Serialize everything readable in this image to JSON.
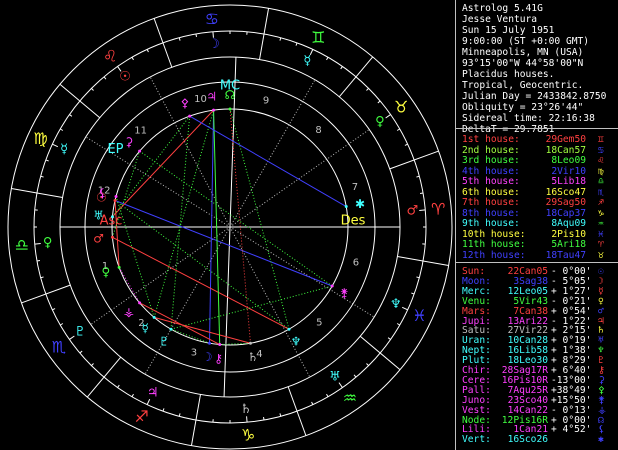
{
  "app": {
    "title": "Astrolog 5.41G"
  },
  "chart_info": {
    "name": "Jesse Ventura",
    "date": "Sun 15 July 1951",
    "time": "9:00:00 (ST +0:00 GMT)",
    "place": "Minneapolis, MN (USA)",
    "coords": "93°15'00\"W 44°58'00\"N",
    "system": "Placidus houses.",
    "zodiac": "Tropical, Geocentric.",
    "julian": "Julian Day = 2433842.8750",
    "obliquity": "Obliquity = 23°26'44\"",
    "sidereal": "Sidereal time: 22:16:38",
    "deltat": "DeltaT = 29.7851"
  },
  "houses": [
    {
      "label": "1st house:",
      "value": "29Gem50",
      "glyph": "♊",
      "color": "#ff4040",
      "gcolor": "#ff4040"
    },
    {
      "label": "2nd house:",
      "value": "18Can57",
      "glyph": "♋",
      "color": "#a0ff40",
      "gcolor": "#4040ff"
    },
    {
      "label": "3rd house:",
      "value": "8Leo09",
      "glyph": "♌",
      "color": "#40ff40",
      "gcolor": "#ff4040"
    },
    {
      "label": "4th house:",
      "value": "2Vir10",
      "glyph": "♍",
      "color": "#4040ff",
      "gcolor": "#ffff40"
    },
    {
      "label": "5th house:",
      "value": "5Lib18",
      "glyph": "♎",
      "color": "#ff40ff",
      "gcolor": "#40ff40"
    },
    {
      "label": "6th house:",
      "value": "16Sco47",
      "glyph": "♏",
      "color": "#ffff40",
      "gcolor": "#4040ff"
    },
    {
      "label": "7th house:",
      "value": "29Sag50",
      "glyph": "♐",
      "color": "#ff4040",
      "gcolor": "#ff4040"
    },
    {
      "label": "8th house:",
      "value": "18Cap37",
      "glyph": "♑",
      "color": "#4040ff",
      "gcolor": "#ffff40"
    },
    {
      "label": "9th house:",
      "value": "8Aqu09",
      "glyph": "♒",
      "color": "#40ffff",
      "gcolor": "#40ff40"
    },
    {
      "label": "10th house:",
      "value": "2Pis10",
      "glyph": "♓",
      "color": "#ffff40",
      "gcolor": "#4040ff"
    },
    {
      "label": "11th house:",
      "value": "5Ari18",
      "glyph": "♈",
      "color": "#40ff40",
      "gcolor": "#ff4040"
    },
    {
      "label": "12th house:",
      "value": "18Tau47",
      "glyph": "♉",
      "color": "#4040ff",
      "gcolor": "#ffff40"
    }
  ],
  "planets": [
    {
      "label": "Sun:",
      "pos": "22Can05",
      "lat": "- 0°00'",
      "glyph": "☉",
      "color": "#ff4040",
      "pcolor": "#4040ff"
    },
    {
      "label": "Moon:",
      "pos": "3Sag38",
      "lat": "- 5°05'",
      "glyph": "☽",
      "color": "#4040ff",
      "pcolor": "#ff4040"
    },
    {
      "label": "Merc:",
      "pos": "12Leo05",
      "lat": "+ 1°27'",
      "glyph": "☿",
      "color": "#40ffff",
      "pcolor": "#ff4040"
    },
    {
      "label": "Venu:",
      "pos": "5Vir43",
      "lat": "- 0°21'",
      "glyph": "♀",
      "color": "#40ff40",
      "pcolor": "#ffff40"
    },
    {
      "label": "Mars:",
      "pos": "7Can38",
      "lat": "+ 0°54'",
      "glyph": "♂",
      "color": "#ff4040",
      "pcolor": "#4040ff"
    },
    {
      "label": "Jupi:",
      "pos": "13Ari22",
      "lat": "- 1°22'",
      "glyph": "♃",
      "color": "#ff40ff",
      "pcolor": "#ff4040"
    },
    {
      "label": "Satu:",
      "pos": "27Vir22",
      "lat": "+ 2°15'",
      "glyph": "♄",
      "color": "#c0c0c0",
      "pcolor": "#ffff40"
    },
    {
      "label": "Uran:",
      "pos": "10Can28",
      "lat": "+ 0°19'",
      "glyph": "♅",
      "color": "#40ffff",
      "pcolor": "#4040ff"
    },
    {
      "label": "Nept:",
      "pos": "16Lib58",
      "lat": "+ 1°38'",
      "glyph": "♆",
      "color": "#40ffff",
      "pcolor": "#40ff40"
    },
    {
      "label": "Plut:",
      "pos": "18Leo30",
      "lat": "+ 8°29'",
      "glyph": "♇",
      "color": "#40ffff",
      "pcolor": "#ff4040"
    },
    {
      "label": "Chir:",
      "pos": "28Sag17R",
      "lat": "+ 6°40'",
      "glyph": "⚷",
      "color": "#ff40ff",
      "pcolor": "#ff4040"
    },
    {
      "label": "Cere:",
      "pos": "16Pis10R",
      "lat": "-13°00'",
      "glyph": "⚳",
      "color": "#ff40ff",
      "pcolor": "#4040ff"
    },
    {
      "label": "Pall:",
      "pos": "7Aqu25R",
      "lat": "+38°49'",
      "glyph": "⚴",
      "color": "#ff40ff",
      "pcolor": "#40ff40"
    },
    {
      "label": "Juno:",
      "pos": "23Sco40",
      "lat": "+15°50'",
      "glyph": "⚵",
      "color": "#ff40ff",
      "pcolor": "#4040ff"
    },
    {
      "label": "Vest:",
      "pos": "14Can22",
      "lat": "- 0°13'",
      "glyph": "⚶",
      "color": "#ff40ff",
      "pcolor": "#4040ff"
    },
    {
      "label": "Node:",
      "pos": "12Pis16R",
      "lat": "+ 0°00'",
      "glyph": "☊",
      "color": "#40ff40",
      "pcolor": "#4040ff"
    },
    {
      "label": "Lili:",
      "pos": "1Can21",
      "lat": "+ 4°52'",
      "glyph": "⚸",
      "color": "#ff40ff",
      "pcolor": "#4040ff"
    },
    {
      "label": "Vert:",
      "pos": "16Sco26",
      "lat": "",
      "glyph": "✱",
      "color": "#40ffff",
      "pcolor": "#4040ff"
    }
  ],
  "wheel": {
    "signs": [
      {
        "glyph": "♈",
        "color": "#ff4040"
      },
      {
        "glyph": "♉",
        "color": "#ffff40"
      },
      {
        "glyph": "♊",
        "color": "#40ff40"
      },
      {
        "glyph": "♋",
        "color": "#4040ff"
      },
      {
        "glyph": "♌",
        "color": "#ff4040"
      },
      {
        "glyph": "♍",
        "color": "#ffff40"
      },
      {
        "glyph": "♎",
        "color": "#40ff40"
      },
      {
        "glyph": "♏",
        "color": "#4040ff"
      },
      {
        "glyph": "♐",
        "color": "#ff4040"
      },
      {
        "glyph": "♑",
        "color": "#ffff40"
      },
      {
        "glyph": "♒",
        "color": "#40ff40"
      },
      {
        "glyph": "♓",
        "color": "#4040ff"
      }
    ],
    "rulers": [
      {
        "glyph": "♂",
        "color": "#ff4040"
      },
      {
        "glyph": "♀",
        "color": "#40ff40"
      },
      {
        "glyph": "☿",
        "color": "#40ffff"
      },
      {
        "glyph": "☽",
        "color": "#4040ff"
      },
      {
        "glyph": "☉",
        "color": "#ff4040"
      },
      {
        "glyph": "☿",
        "color": "#40ffff"
      },
      {
        "glyph": "♀",
        "color": "#40ff40"
      },
      {
        "glyph": "♇",
        "color": "#40ffff"
      },
      {
        "glyph": "♃",
        "color": "#ff40ff"
      },
      {
        "glyph": "♄",
        "color": "#c0c0c0"
      },
      {
        "glyph": "♅",
        "color": "#40ffff"
      },
      {
        "glyph": "♆",
        "color": "#40ffff"
      }
    ],
    "house_numbers": [
      "1",
      "2",
      "3",
      "4",
      "5",
      "6",
      "7",
      "8",
      "9",
      "10",
      "11",
      "12"
    ],
    "angles": {
      "asc": "Asc",
      "mc": "MC",
      "des": "Des",
      "ic": "IC",
      "ep": "EP"
    },
    "colors": {
      "ring": "#ffffff",
      "cusp": "#c0c0c0",
      "house_num": "#c0c0c0"
    },
    "aspects": [
      {
        "a": 0,
        "b": 3,
        "color": "#ff4040",
        "dash": false
      },
      {
        "a": 0,
        "b": 8,
        "color": "#40ff40",
        "dash": true
      },
      {
        "a": 0,
        "b": 13,
        "color": "#4040ff",
        "dash": false
      },
      {
        "a": 1,
        "b": 5,
        "color": "#4040ff",
        "dash": false
      },
      {
        "a": 1,
        "b": 9,
        "color": "#40ff40",
        "dash": true
      },
      {
        "a": 2,
        "b": 6,
        "color": "#ff4040",
        "dash": false
      },
      {
        "a": 2,
        "b": 5,
        "color": "#40ff40",
        "dash": true
      },
      {
        "a": 4,
        "b": 11,
        "color": "#40ff40",
        "dash": true
      },
      {
        "a": 4,
        "b": 8,
        "color": "#ff4040",
        "dash": false
      },
      {
        "a": 5,
        "b": 7,
        "color": "#ff4040",
        "dash": false
      },
      {
        "a": 5,
        "b": 10,
        "color": "#40ff40",
        "dash": false
      },
      {
        "a": 6,
        "b": 10,
        "color": "#40ff40",
        "dash": true
      },
      {
        "a": 6,
        "b": 15,
        "color": "#ff4040",
        "dash": true
      },
      {
        "a": 7,
        "b": 12,
        "color": "#40ff40",
        "dash": true
      },
      {
        "a": 8,
        "b": 15,
        "color": "#40ff40",
        "dash": true
      },
      {
        "a": 9,
        "b": 13,
        "color": "#40ff40",
        "dash": true
      },
      {
        "a": 9,
        "b": 12,
        "color": "#40ff40",
        "dash": true
      },
      {
        "a": 10,
        "b": 14,
        "color": "#ff4040",
        "dash": false
      },
      {
        "a": 11,
        "b": 13,
        "color": "#40ff40",
        "dash": true
      },
      {
        "a": 3,
        "b": 14,
        "color": "#ff40ff",
        "dash": true
      },
      {
        "a": 2,
        "b": 16,
        "color": "#40ff40",
        "dash": true
      },
      {
        "a": 12,
        "b": 17,
        "color": "#4040ff",
        "dash": false
      }
    ]
  }
}
